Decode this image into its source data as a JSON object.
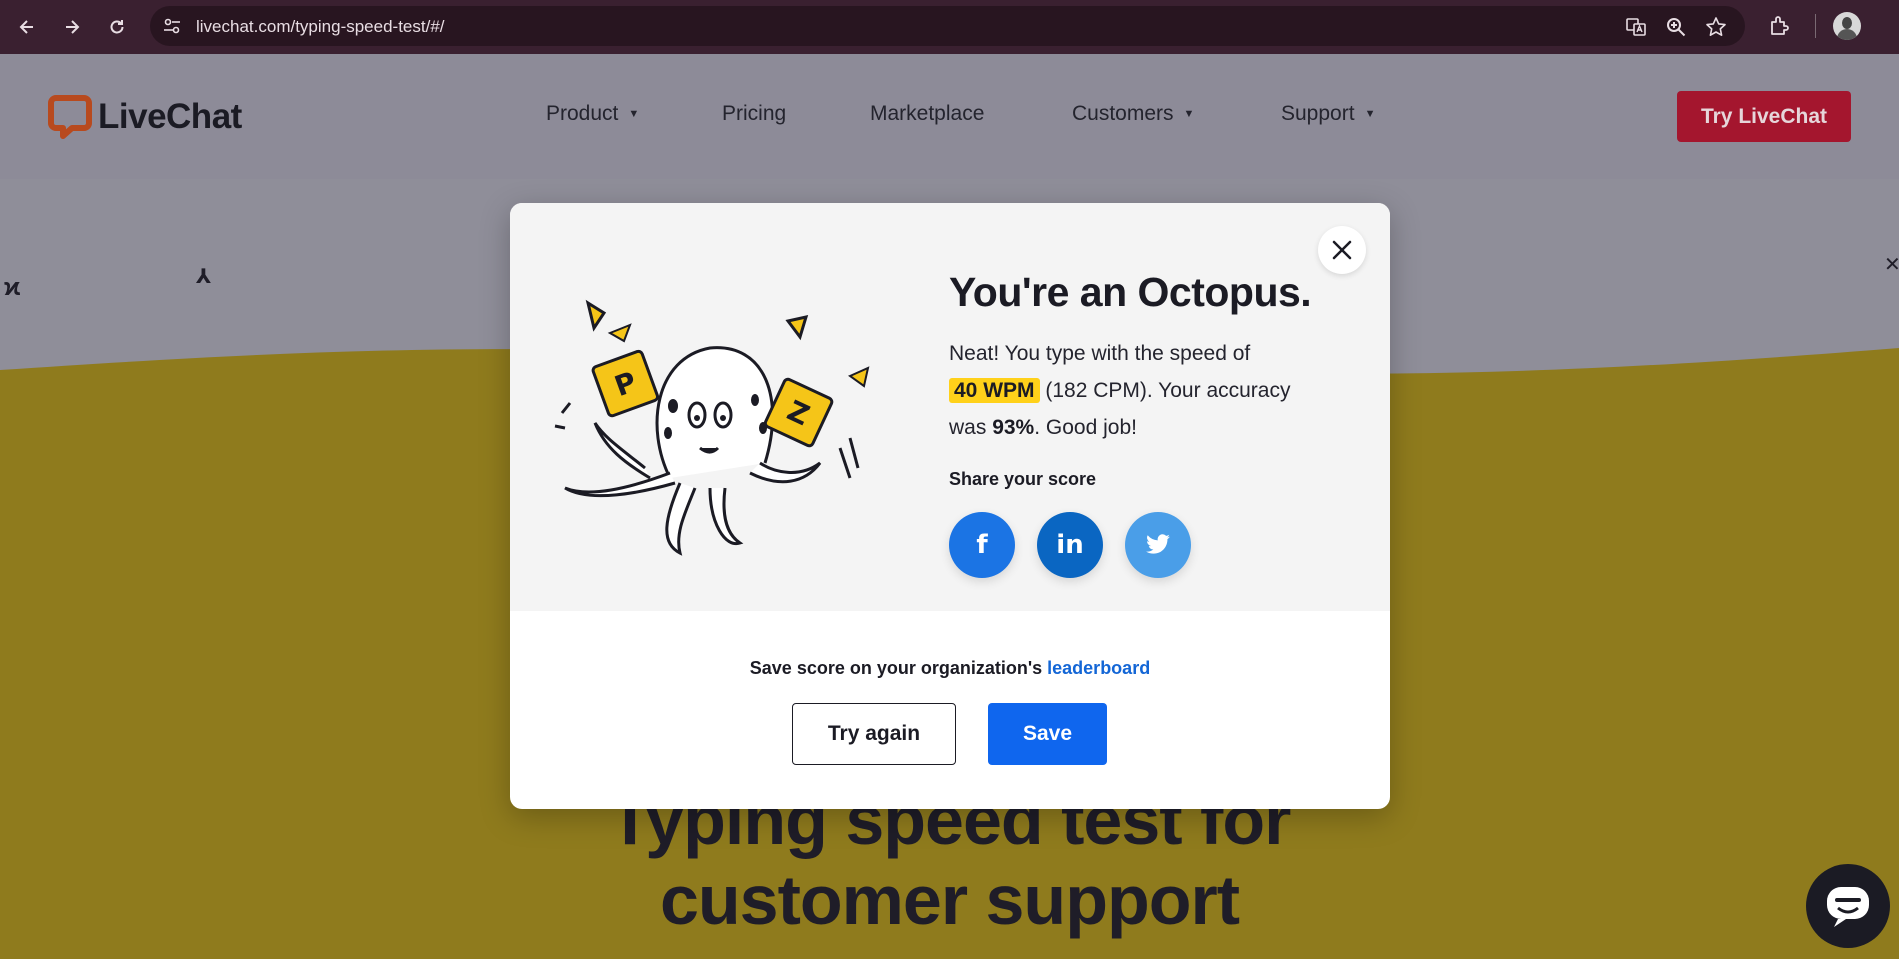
{
  "browser": {
    "url": "livechat.com/typing-speed-test/#/"
  },
  "header": {
    "logo_text": "LiveChat",
    "nav": [
      {
        "label": "Product",
        "has_dropdown": true
      },
      {
        "label": "Pricing",
        "has_dropdown": false
      },
      {
        "label": "Marketplace",
        "has_dropdown": false
      },
      {
        "label": "Customers",
        "has_dropdown": true
      },
      {
        "label": "Support",
        "has_dropdown": true
      }
    ],
    "cta_label": "Try LiveChat",
    "caret": "▼"
  },
  "hero": {
    "title_line1": "Typing speed test for",
    "title_line2": "customer support"
  },
  "modal": {
    "heading": "You're an Octopus.",
    "text_intro": "Neat! You type with the speed of",
    "wpm": "40 WPM",
    "cpm_text": "(182 CPM). Your accuracy",
    "was": "was",
    "accuracy": "93%",
    "good_job": ". Good job!",
    "share_label": "Share your score",
    "share": {
      "facebook": "f",
      "linkedin": "in",
      "twitter_color": "#4a9ee8",
      "facebook_color": "#1b74e4",
      "linkedin_color": "#0a66c2"
    },
    "leader_prefix": "Save score on your organization's",
    "leader_link": "leaderboard",
    "try_again": "Try again",
    "save": "Save",
    "illustration_letters": [
      "P",
      "Z"
    ]
  }
}
